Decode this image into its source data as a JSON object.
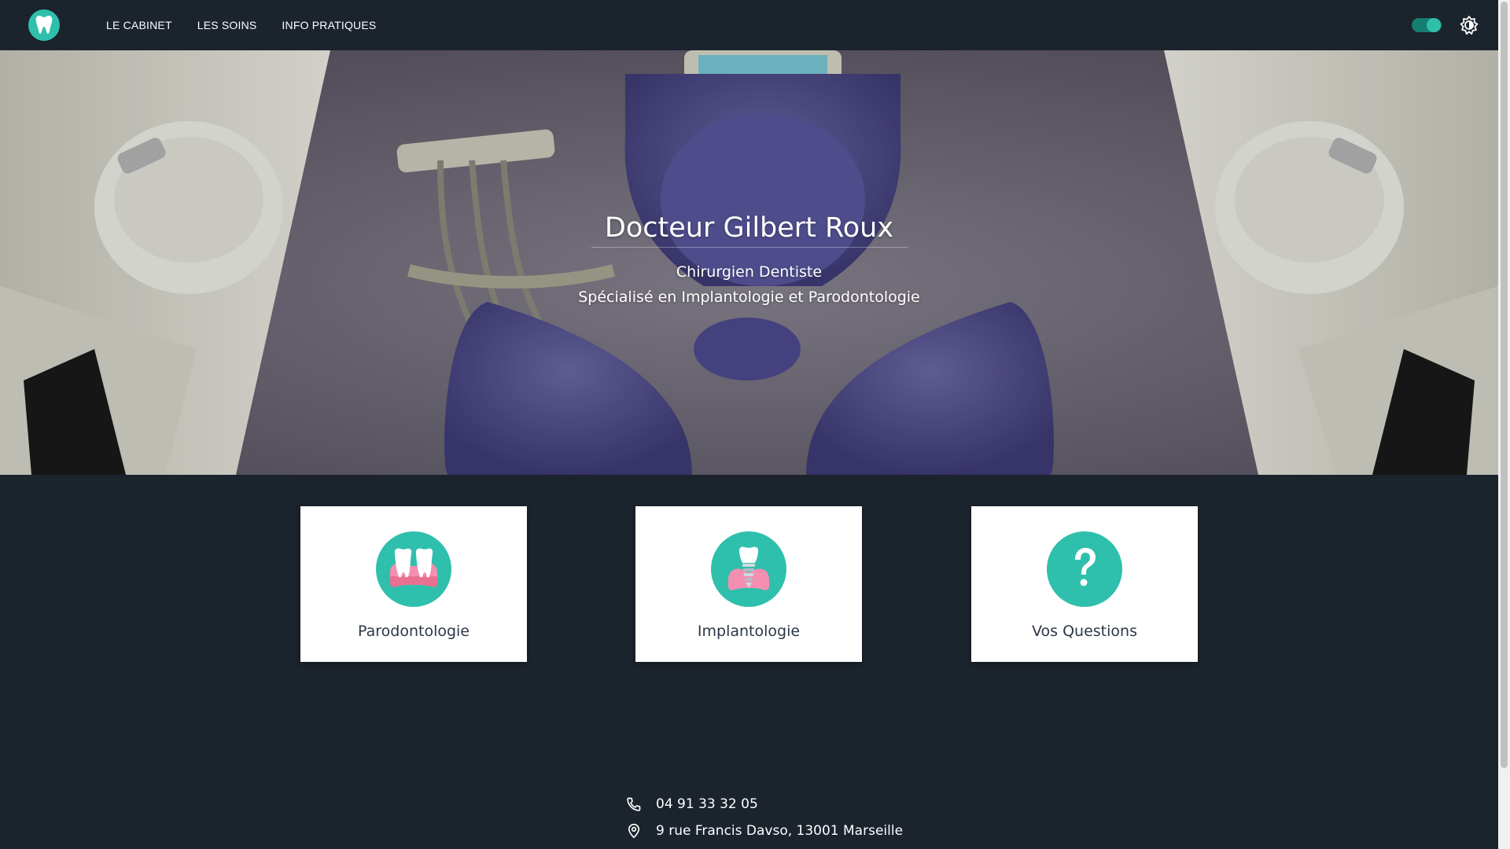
{
  "nav": {
    "logo_icon": "tooth-icon",
    "links": [
      "LE CABINET",
      "LES SOINS",
      "INFO PRATIQUES"
    ],
    "theme_toggle_on": true,
    "brightness_icon": "brightness-icon"
  },
  "hero": {
    "title": "Docteur Gilbert Roux",
    "subtitle": "Chirurgien Dentiste",
    "specialty": "Spécialisé en Implantologie et Parodontologie"
  },
  "cards": [
    {
      "label": "Parodontologie",
      "icon": "gums-teeth-icon"
    },
    {
      "label": "Implantologie",
      "icon": "dental-implant-icon"
    },
    {
      "label": "Vos Questions",
      "icon": "question-mark-icon"
    }
  ],
  "contact": {
    "phone": "04 91 33 32 05",
    "address": "9 rue Francis Davso, 13001 Marseille"
  },
  "colors": {
    "background": "#1b232d",
    "accent": "#2fbfad",
    "card_bg": "#ffffff",
    "card_text": "#2d3748",
    "gum_pink": "#f48fb1"
  }
}
